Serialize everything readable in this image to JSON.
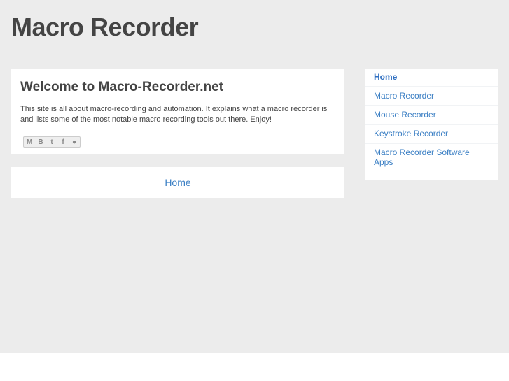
{
  "header": {
    "title": "Macro Recorder"
  },
  "post": {
    "title": "Welcome to Macro-Recorder.net",
    "body": "This site is all about macro-recording and automation. It explains what a macro recorder is and lists some of the most notable macro recording tools out there. Enjoy!",
    "share_buttons": [
      {
        "icon": "email-icon",
        "glyph": "M"
      },
      {
        "icon": "blogger-icon",
        "glyph": "B"
      },
      {
        "icon": "twitter-icon",
        "glyph": "t"
      },
      {
        "icon": "facebook-icon",
        "glyph": "f"
      },
      {
        "icon": "buzz-icon",
        "glyph": "●"
      }
    ]
  },
  "pager": {
    "home_label": "Home"
  },
  "sidebar": {
    "items": [
      {
        "label": "Home"
      },
      {
        "label": "Macro Recorder"
      },
      {
        "label": "Mouse Recorder"
      },
      {
        "label": "Keystroke Recorder"
      },
      {
        "label": "Macro Recorder Software Apps"
      }
    ]
  }
}
